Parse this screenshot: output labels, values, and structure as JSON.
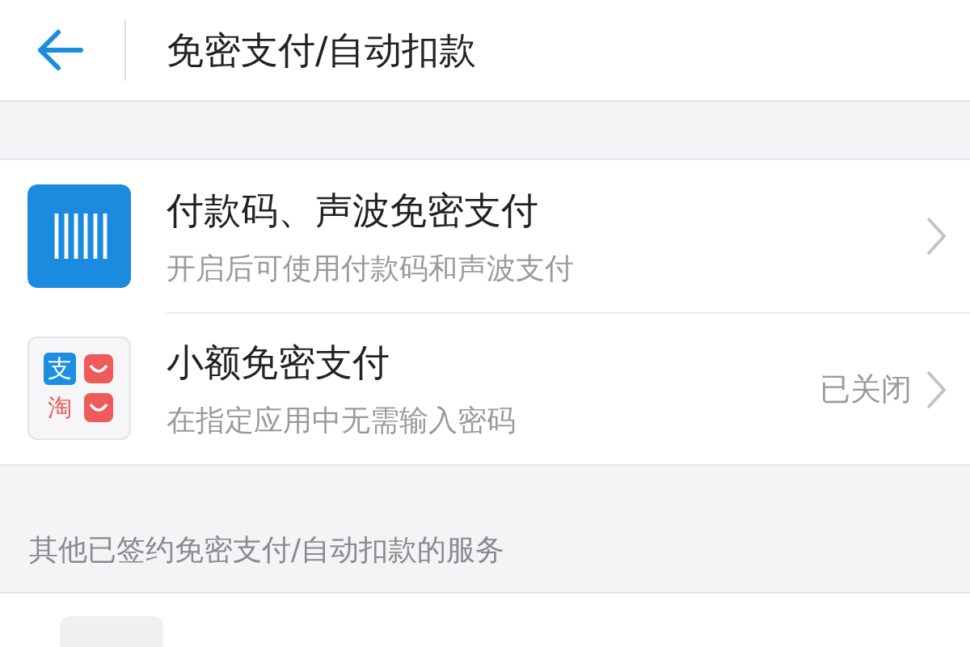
{
  "header": {
    "title": "免密支付/自动扣款"
  },
  "items": [
    {
      "kind": "barcode",
      "title": "付款码、声波免密支付",
      "subtitle": "开启后可使用付款码和声波支付"
    },
    {
      "kind": "apps",
      "title": "小额免密支付",
      "subtitle": "在指定应用中无需输入密码",
      "status": "已关闭",
      "app_glyphs": [
        "支",
        "淘"
      ]
    }
  ],
  "section_label": "其他已签约免密支付/自动扣款的服务"
}
